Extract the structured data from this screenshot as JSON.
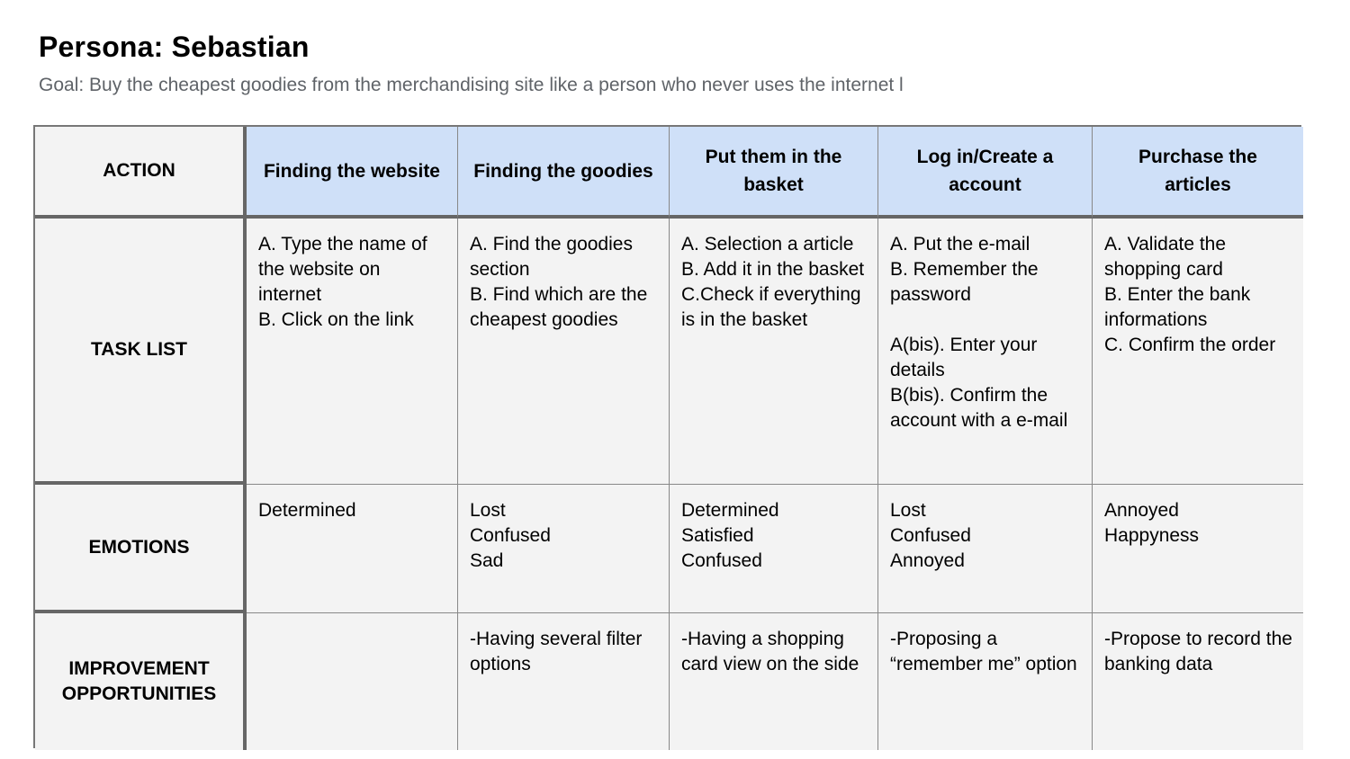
{
  "title": "Persona: Sebastian",
  "goal": "Goal: Buy the cheapest goodies from the merchandising site like a person who never uses the internet l",
  "table": {
    "row_headers": [
      "ACTION",
      "TASK LIST",
      "EMOTIONS",
      "IMPROVEMENT OPPORTUNITIES"
    ],
    "columns": [
      "Finding the website",
      "Finding the goodies",
      "Put them in the basket",
      "Log in/Create a account",
      "Purchase the articles"
    ],
    "task_list": [
      "A. Type the name of the website on internet\nB.  Click on the link",
      "A. Find the goodies section\nB. Find which are the cheapest goodies",
      "A. Selection a article\nB. Add it in the basket\nC.Check if everything is in the basket",
      "A. Put the e-mail\nB. Remember the password\n\nA(bis). Enter your details\nB(bis). Confirm the account with a e-mail",
      "A. Validate the shopping card\nB. Enter the bank informations\nC. Confirm the order"
    ],
    "emotions": [
      "Determined",
      "Lost\nConfused\nSad",
      "Determined\nSatisfied\nConfused",
      "Lost\nConfused\nAnnoyed",
      "Annoyed\nHappyness"
    ],
    "improvements": [
      "",
      "-Having several filter options",
      "-Having a shopping card view on the side",
      "-Proposing a “remember me” option",
      "-Propose to record the banking data"
    ]
  },
  "colors": {
    "header_fill": "#cfe0f8",
    "cell_fill": "#f3f3f3",
    "goal_text": "#5f6368"
  }
}
